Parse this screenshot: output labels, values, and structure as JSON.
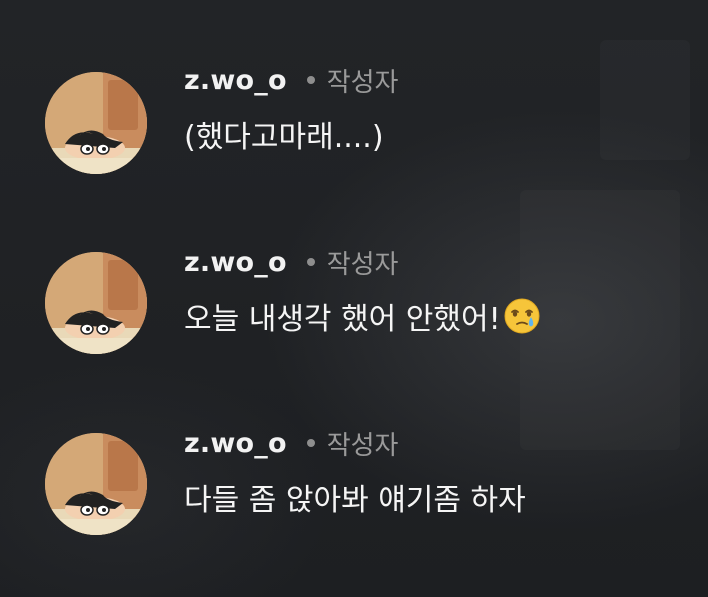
{
  "comments": [
    {
      "username": "z.wo_o",
      "author_tag": "작성자",
      "text": "(했다고마래....)",
      "emoji": null
    },
    {
      "username": "z.wo_o",
      "author_tag": "작성자",
      "text": "오늘 내생각 했어 안했어!",
      "emoji": "face-holding-back-tears"
    },
    {
      "username": "z.wo_o",
      "author_tag": "작성자",
      "text": "다들 좀 앉아봐 얘기좀 하자",
      "emoji": null
    }
  ],
  "avatar_icon": "shin-chan-peeking-avatar",
  "colors": {
    "background": "#1f2124",
    "username": "#f2f2f2",
    "author_tag": "#9a9a9a",
    "message": "#f5f5f5"
  }
}
